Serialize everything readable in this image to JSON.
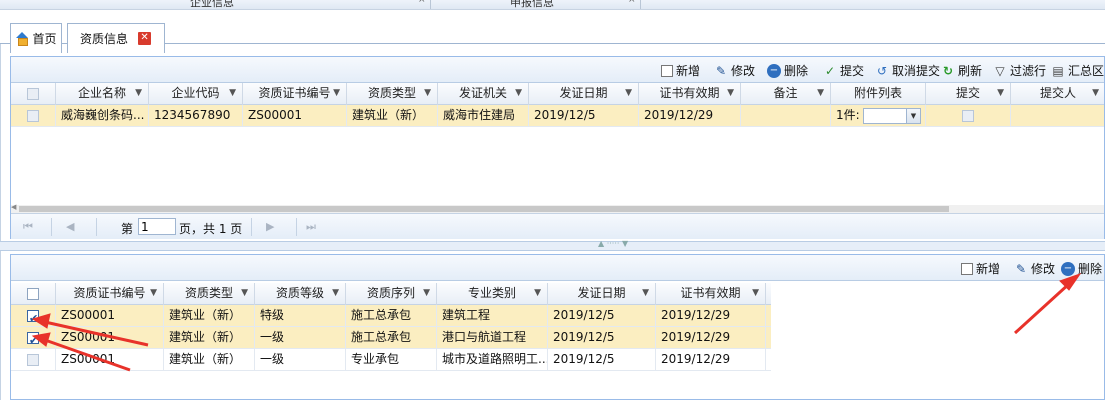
{
  "top_strip": {
    "left_title": "企业信息",
    "right_title": "申报信息",
    "close_glyph": "×"
  },
  "tabs": [
    {
      "label": "首页",
      "icon": "home-icon"
    },
    {
      "label": "资质信息",
      "close_icon": "close-icon",
      "close_glyph": "✕"
    }
  ],
  "upper": {
    "toolbar": {
      "add": "新增",
      "edit": "修改",
      "delete": "删除",
      "submit": "提交",
      "cancel_submit": "取消提交",
      "refresh": "刷新",
      "filter": "过滤行",
      "summary": "汇总区"
    },
    "columns": [
      "企业名称",
      "企业代码",
      "资质证书编号",
      "资质类型",
      "发证机关",
      "发证日期",
      "证书有效期",
      "备注",
      "附件列表",
      "提交",
      "提交人"
    ],
    "rows": [
      {
        "cells": [
          "威海巍创条码...",
          "1234567890",
          "ZS00001",
          "建筑业（新）",
          "威海市住建局",
          "2019/12/5",
          "2019/12/29",
          "",
          "1件:",
          "",
          ""
        ]
      }
    ],
    "pager": {
      "page_prefix": "第",
      "page_value": "1",
      "page_suffix": "页，共 1 页"
    }
  },
  "lower": {
    "toolbar": {
      "add": "新增",
      "edit": "修改",
      "delete": "删除"
    },
    "columns": [
      "资质证书编号",
      "资质类型",
      "资质等级",
      "资质序列",
      "专业类别",
      "发证日期",
      "证书有效期"
    ],
    "rows": [
      {
        "checked": true,
        "cells": [
          "ZS00001",
          "建筑业（新）",
          "特级",
          "施工总承包",
          "建筑工程",
          "2019/12/5",
          "2019/12/29"
        ]
      },
      {
        "checked": true,
        "cells": [
          "ZS00001",
          "建筑业（新）",
          "一级",
          "施工总承包",
          "港口与航道工程",
          "2019/12/5",
          "2019/12/29"
        ]
      },
      {
        "checked": false,
        "cells": [
          "ZS00001",
          "建筑业（新）",
          "一级",
          "专业承包",
          "城市及道路照明工...",
          "2019/12/5",
          "2019/12/29"
        ]
      }
    ]
  },
  "annotations": {
    "arrow_color": "#e8322a"
  },
  "colors": {
    "selected_row": "#fbeec1",
    "border": "#99bbe8",
    "header": "#e8eef6"
  }
}
